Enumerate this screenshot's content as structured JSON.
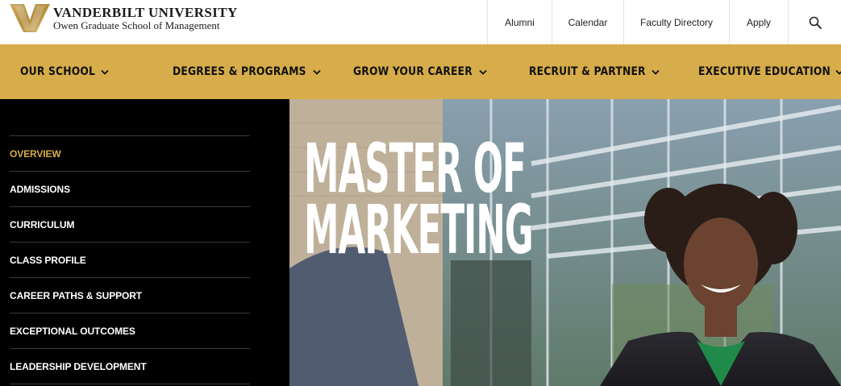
{
  "brand": {
    "title": "VANDERBILT UNIVERSITY",
    "subtitle": "Owen Graduate School of Management",
    "gold": "#d7ac4a",
    "black": "#000000"
  },
  "utility_nav": [
    {
      "label": "Alumni"
    },
    {
      "label": "Calendar"
    },
    {
      "label": "Faculty Directory"
    },
    {
      "label": "Apply"
    }
  ],
  "search": {
    "icon": "search-icon"
  },
  "main_nav": [
    {
      "label": "Our School"
    },
    {
      "label": "Degrees & Programs"
    },
    {
      "label": "Grow Your Career"
    },
    {
      "label": "Recruit & Partner"
    },
    {
      "label": "Executive Education"
    }
  ],
  "sidebar": {
    "items": [
      {
        "label": "Overview",
        "active": true
      },
      {
        "label": "Admissions"
      },
      {
        "label": "Curriculum"
      },
      {
        "label": "Class Profile"
      },
      {
        "label": "Career Paths & Support"
      },
      {
        "label": "Exceptional Outcomes"
      },
      {
        "label": "Leadership Development"
      }
    ]
  },
  "hero": {
    "title_line1": "Master of",
    "title_line2": "Marketing"
  }
}
